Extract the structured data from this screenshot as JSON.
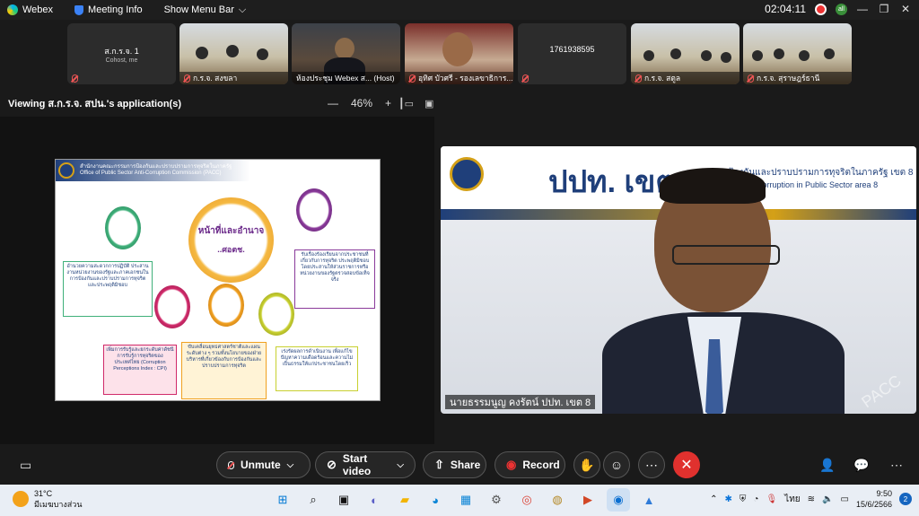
{
  "titlebar": {
    "app_name": "Webex",
    "meeting_info": "Meeting Info",
    "menu_bar": "Show Menu Bar",
    "menu_chevron": "⌵",
    "timer": "02:04:11",
    "audio_badge": "all",
    "minimize": "—",
    "restore": "❐",
    "close": "✕"
  },
  "participants": [
    {
      "title": "ส.ก.ร.จ. 1",
      "subtitle": "Cohost, me",
      "name": ""
    },
    {
      "title": "",
      "subtitle": "",
      "name": "ก.ร.จ. สงขลา"
    },
    {
      "title": "",
      "subtitle": "",
      "name": "ห้องประชุม Webex ส... (Host)"
    },
    {
      "title": "",
      "subtitle": "",
      "name": "อุทิศ บัวศรี - รองเลขาธิการ..."
    },
    {
      "title": "1761938595",
      "subtitle": "",
      "name": ""
    },
    {
      "title": "",
      "subtitle": "",
      "name": "ก.ร.จ. สตูล"
    },
    {
      "title": "",
      "subtitle": "",
      "name": "ก.ร.จ. สุราษฎร์ธานี"
    }
  ],
  "view": {
    "title": "Viewing ส.ก.ร.จ. สปน.'s application(s)",
    "zoom_minus": "—",
    "zoom_level": "46%",
    "zoom_plus": "+"
  },
  "slide": {
    "header_th": "สำนักงานคณะกรรมการป้องกันและปราบปรามการทุจริตในภาครัฐ",
    "header_en": "Office of Public Sector Anti-Corruption Commission (PACC)",
    "center_title": "หน้าที่และอำนาจ",
    "center_sub": "..ศอตช.",
    "box_left": "อำนวยความสะดวกการปฏิบัติ ประสานงานหน่วยงานของรัฐและภาคเอกชนในการป้องกันและปราบปรามการทุจริตและประพฤติมิชอบ",
    "box_right": "รับเรื่องร้องเรียนจากประชาชนที่เกี่ยวกับการทุจริต ประพฤติมิชอบ โดยประสานให้ส่วนราชการหรือหน่วยงานของรัฐตรวจสอบข้อเท็จจริง",
    "box_cpi": "เพิ่มการรับรู้และยกระดับค่าดัชนีการรับรู้การทุจริตของประเทศไทย (Corruption Perceptions Index : CPI)",
    "box_policy": "ขับเคลื่อนยุทธศาสตร์ชาติและแผนระดับต่าง ๆ รวมทั้งนโยบายของฝ่ายบริหารที่เกี่ยวข้องกับการป้องกันและปราบปรามการทุจริต",
    "box_fast": "เร่งรัดผลการดำเนินงาน เพื่อแก้ไขปัญหาความเดือดร้อนและความไม่เป็นธรรมให้แก่ประชาชนโดยเร็ว"
  },
  "speaker": {
    "banner_big": "ปปท. เขต 8",
    "banner_th": "ป้องกันและปราบปรามการทุจริตในภาครัฐ เขต 8",
    "banner_en": "Corruption in Public Sector area 8",
    "watermark": "PACC",
    "name": "นายธรรมนูญ คงรัตน์ ปปท. เขต 8"
  },
  "controls": {
    "unmute": "Unmute",
    "start_video": "Start video",
    "share": "Share",
    "record": "Record",
    "chevron": "⌵"
  },
  "taskbar": {
    "temperature": "31°C",
    "weather_desc": "มีเมฆบางส่วน",
    "language": "ไทย",
    "time": "9:50",
    "date": "15/6/2566",
    "notifications": "2"
  },
  "colors": {
    "end_call": "#e0312e",
    "accent": "#1f3f7a",
    "muted": "#e55555"
  }
}
